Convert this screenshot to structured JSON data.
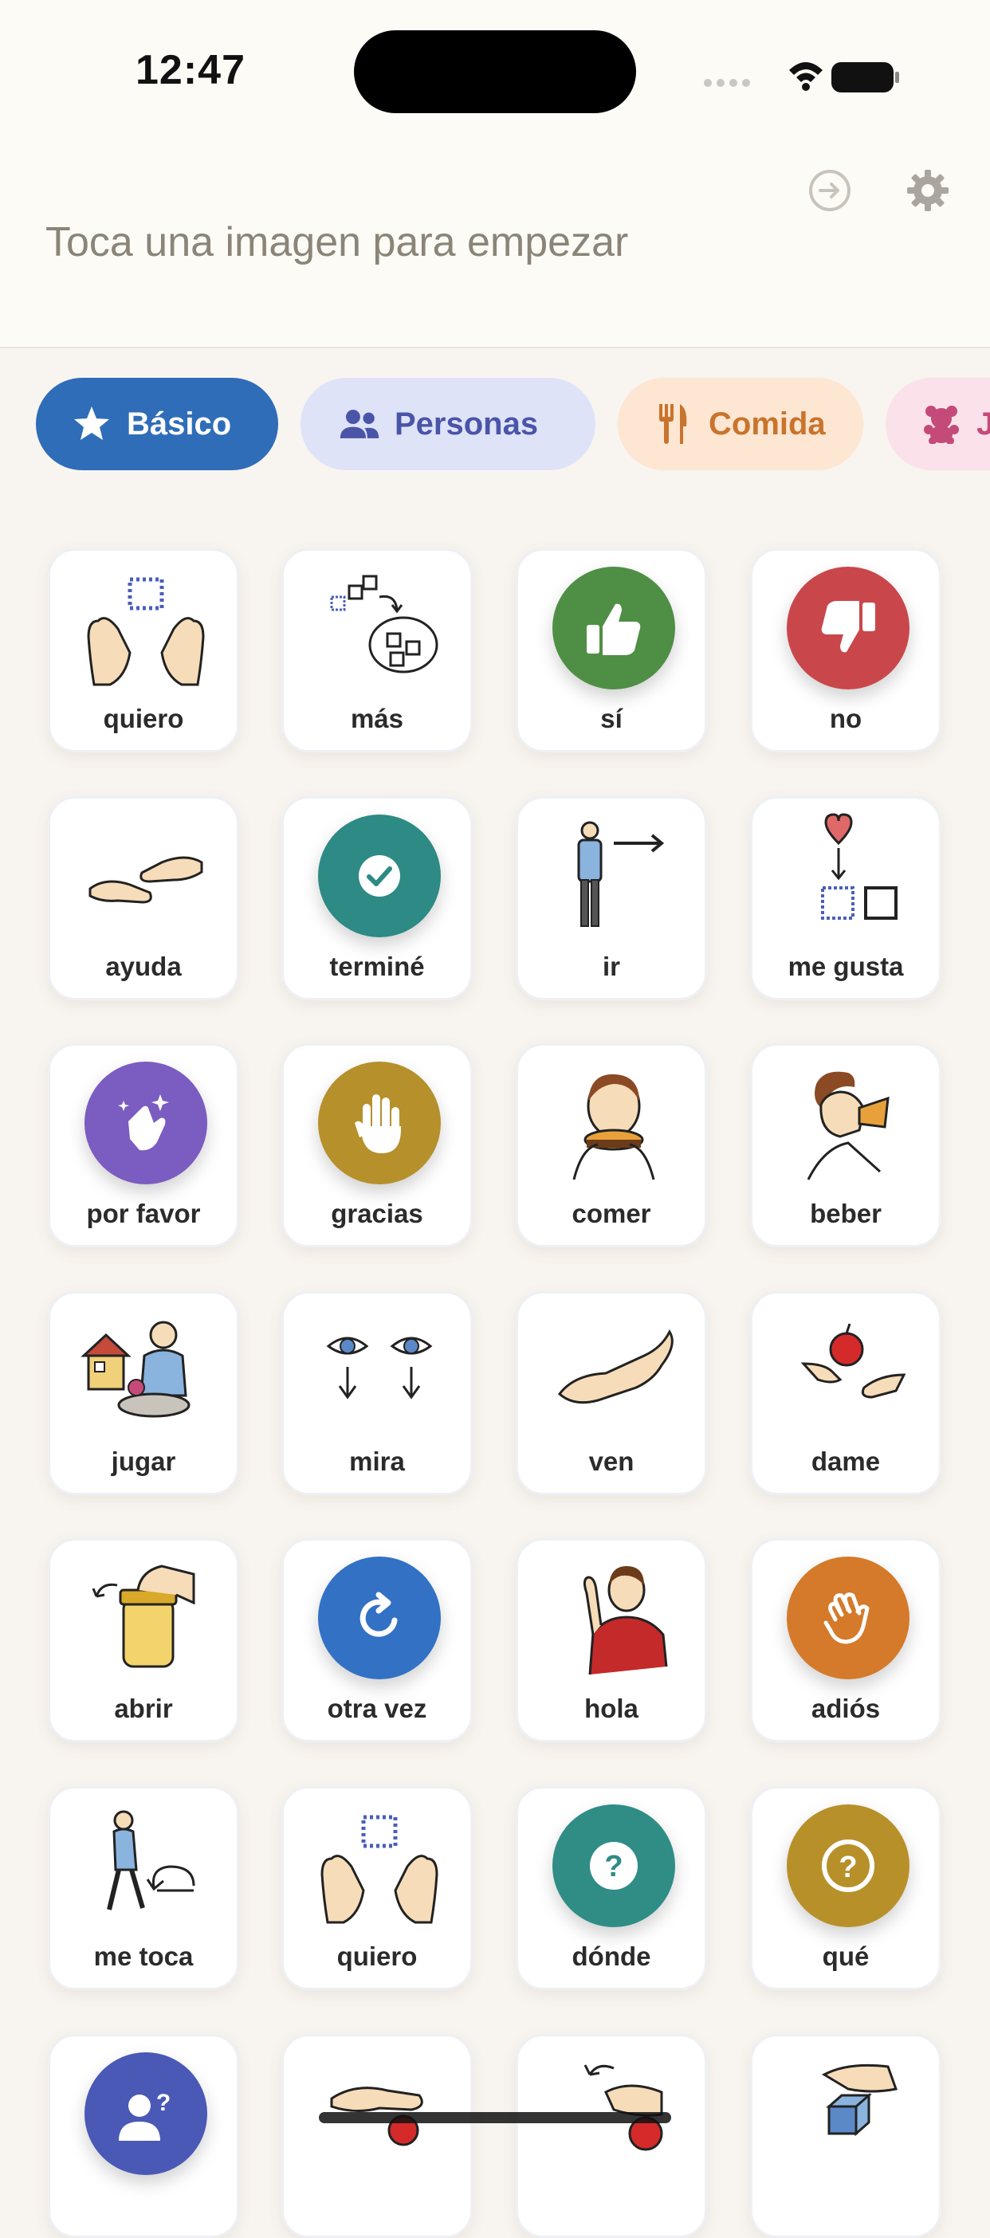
{
  "status_bar": {
    "time": "12:47"
  },
  "header": {
    "prompt": "Toca una imagen para empezar",
    "icons": [
      "arrow-right-circle-icon",
      "gear-icon"
    ]
  },
  "tabs": [
    {
      "label": "Básico",
      "icon": "star-icon",
      "bg": "#2f6db8",
      "fg": "#ffffff",
      "selected": true
    },
    {
      "label": "Personas",
      "icon": "people-icon",
      "bg": "#dfe3f8",
      "fg": "#4a55a8"
    },
    {
      "label": "Comida",
      "icon": "fork-knife-icon",
      "bg": "#fde6d2",
      "fg": "#c8742d"
    },
    {
      "label": "J",
      "icon": "teddy-bear-icon",
      "bg": "#fbe1ea",
      "fg": "#c44a79"
    }
  ],
  "cards": [
    {
      "label": "quiero",
      "icon": "hands-want-icon"
    },
    {
      "label": "más",
      "icon": "more-squares-icon"
    },
    {
      "label": "sí",
      "icon": "thumbs-up-icon",
      "color": "#4f8f45"
    },
    {
      "label": "no",
      "icon": "thumbs-down-icon",
      "color": "#c9474a"
    },
    {
      "label": "ayuda",
      "icon": "help-hands-icon"
    },
    {
      "label": "terminé",
      "icon": "check-icon",
      "color": "#2d8a84"
    },
    {
      "label": "ir",
      "icon": "person-go-icon"
    },
    {
      "label": "me gusta",
      "icon": "heart-like-icon"
    },
    {
      "label": "por favor",
      "icon": "sparkle-hands-icon",
      "color": "#7b5cc0"
    },
    {
      "label": "gracias",
      "icon": "hand-raise-icon",
      "color": "#b5902b"
    },
    {
      "label": "comer",
      "icon": "eating-icon"
    },
    {
      "label": "beber",
      "icon": "drinking-icon"
    },
    {
      "label": "jugar",
      "icon": "playing-icon"
    },
    {
      "label": "mira",
      "icon": "eyes-icon"
    },
    {
      "label": "ven",
      "icon": "come-hand-icon"
    },
    {
      "label": "dame",
      "icon": "give-me-icon"
    },
    {
      "label": "abrir",
      "icon": "open-jar-icon"
    },
    {
      "label": "otra vez",
      "icon": "repeat-icon",
      "color": "#3271c4"
    },
    {
      "label": "hola",
      "icon": "wave-person-icon"
    },
    {
      "label": "adiós",
      "icon": "wave-hand-icon",
      "color": "#d47a2a"
    },
    {
      "label": "me toca",
      "icon": "my-turn-icon"
    },
    {
      "label": "quiero",
      "icon": "hands-want-icon"
    },
    {
      "label": "dónde",
      "icon": "question-icon",
      "color": "#2f8d86"
    },
    {
      "label": "qué",
      "icon": "question-circle-icon",
      "color": "#b8902a"
    },
    {
      "label": "",
      "icon": "person-question-icon",
      "color": "#4a59b5"
    },
    {
      "label": "",
      "icon": "hand-ball-icon"
    },
    {
      "label": "",
      "icon": "hand-turn-icon"
    },
    {
      "label": "",
      "icon": "hand-box-icon"
    }
  ]
}
